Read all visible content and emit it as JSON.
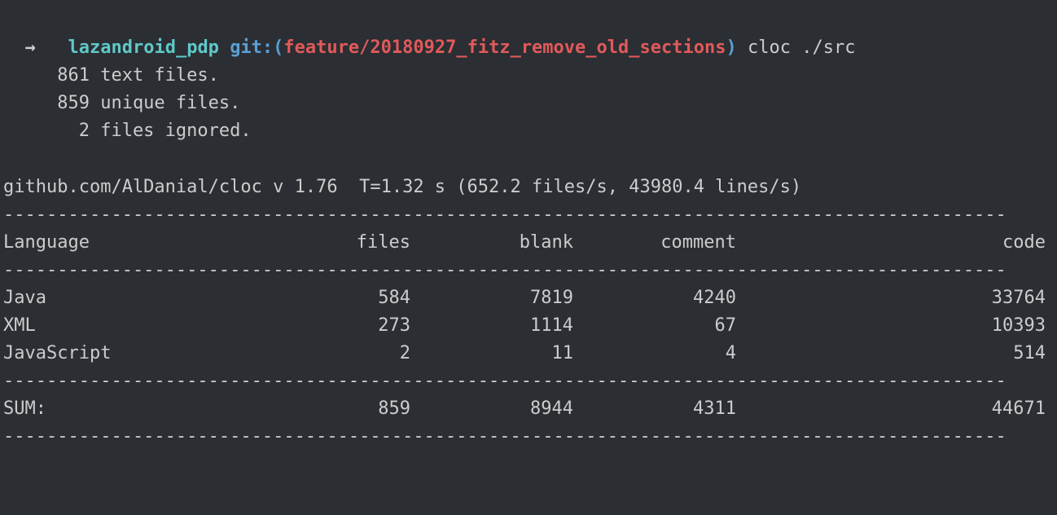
{
  "prompt": {
    "arrow": "→",
    "directory": "lazandroid_pdp",
    "git_label": "git:",
    "paren_open": "(",
    "branch": "feature/20180927_fitz_remove_old_sections",
    "paren_close": ")",
    "command": "cloc ./src"
  },
  "summary": {
    "line1": "     861 text files.",
    "line2": "     859 unique files.",
    "line3": "       2 files ignored."
  },
  "info": "github.com/AlDanial/cloc v 1.76  T=1.32 s (652.2 files/s, 43980.4 lines/s)",
  "divider": "---------------------------------------------------------------------------------------------",
  "headers": {
    "language": "Language",
    "files": "files",
    "blank": "blank",
    "comment": "comment",
    "code": "code"
  },
  "rows": [
    {
      "language": "Java",
      "files": "584",
      "blank": "7819",
      "comment": "4240",
      "code": "33764"
    },
    {
      "language": "XML",
      "files": "273",
      "blank": "1114",
      "comment": "67",
      "code": "10393"
    },
    {
      "language": "JavaScript",
      "files": "2",
      "blank": "11",
      "comment": "4",
      "code": "514"
    }
  ],
  "sum": {
    "language": "SUM:",
    "files": "859",
    "blank": "8944",
    "comment": "4311",
    "code": "44671"
  }
}
